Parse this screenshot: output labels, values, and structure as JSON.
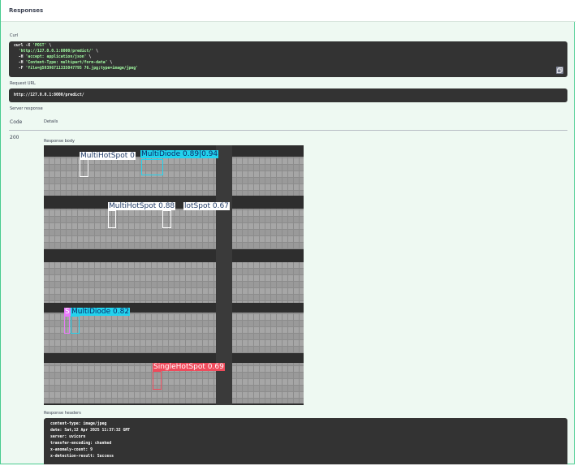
{
  "section_title": "Responses",
  "curl_label": "Curl",
  "curl_lines": [
    {
      "pre": "curl -X ",
      "str": "'POST'",
      "post": " \\"
    },
    {
      "pre": "  ",
      "str": "'http://127.0.0.1:8000/predict/'",
      "post": " \\"
    },
    {
      "pre": "  -H ",
      "str": "'accept: application/json'",
      "post": " \\"
    },
    {
      "pre": "  -H ",
      "str": "'Content-Type: multipart/form-data'",
      "post": " \\"
    },
    {
      "pre": "  -F ",
      "str": "'file=@59396711335047795 76.jpg;type=image/jpeg'",
      "post": ""
    }
  ],
  "request_url_label": "Request URL",
  "request_url": "http://127.0.0.1:8000/predict/",
  "server_response_label": "Server response",
  "code_header": "Code",
  "details_header": "Details",
  "status_code": "200",
  "response_body_label": "Response body",
  "response_headers_label": "Response headers",
  "response_headers": [
    "content-type: image/jpeg",
    "date: Sat,12 Apr 2025 11:37:32 GMT",
    "server: uvicorn",
    "transfer-encoding: chunked",
    "x-anomaly-count: 9",
    "x-detection-result: Success"
  ],
  "detections": [
    {
      "label": "MultiHotSpot  0",
      "color": "#ffffff",
      "text_color": "#1f3a66"
    },
    {
      "label": "MultiDiode  0.89|0.94",
      "color": "#22d3ee",
      "text_color": "#0b2a66"
    },
    {
      "label": "MultiHotSpot  0.88",
      "color": "#ffffff",
      "text_color": "#1f3a66"
    },
    {
      "label": "lotSpot  0.67",
      "color": "#ffffff",
      "text_color": "#1f3a66"
    },
    {
      "label": "S",
      "color": "#e879f9",
      "text_color": "#ffffff"
    },
    {
      "label": "MultiDiode  0.82",
      "color": "#22d3ee",
      "text_color": "#0b2a66"
    },
    {
      "label": "SingleHotSpot  0.69",
      "color": "#ef4b5c",
      "text_color": "#ffffff"
    }
  ],
  "colors": {
    "frame_border": "#49cc90",
    "frame_bg": "#eef9f2",
    "code_bg": "#333333",
    "string": "#a2fca2"
  },
  "icons": {
    "copy": "copy-icon"
  }
}
